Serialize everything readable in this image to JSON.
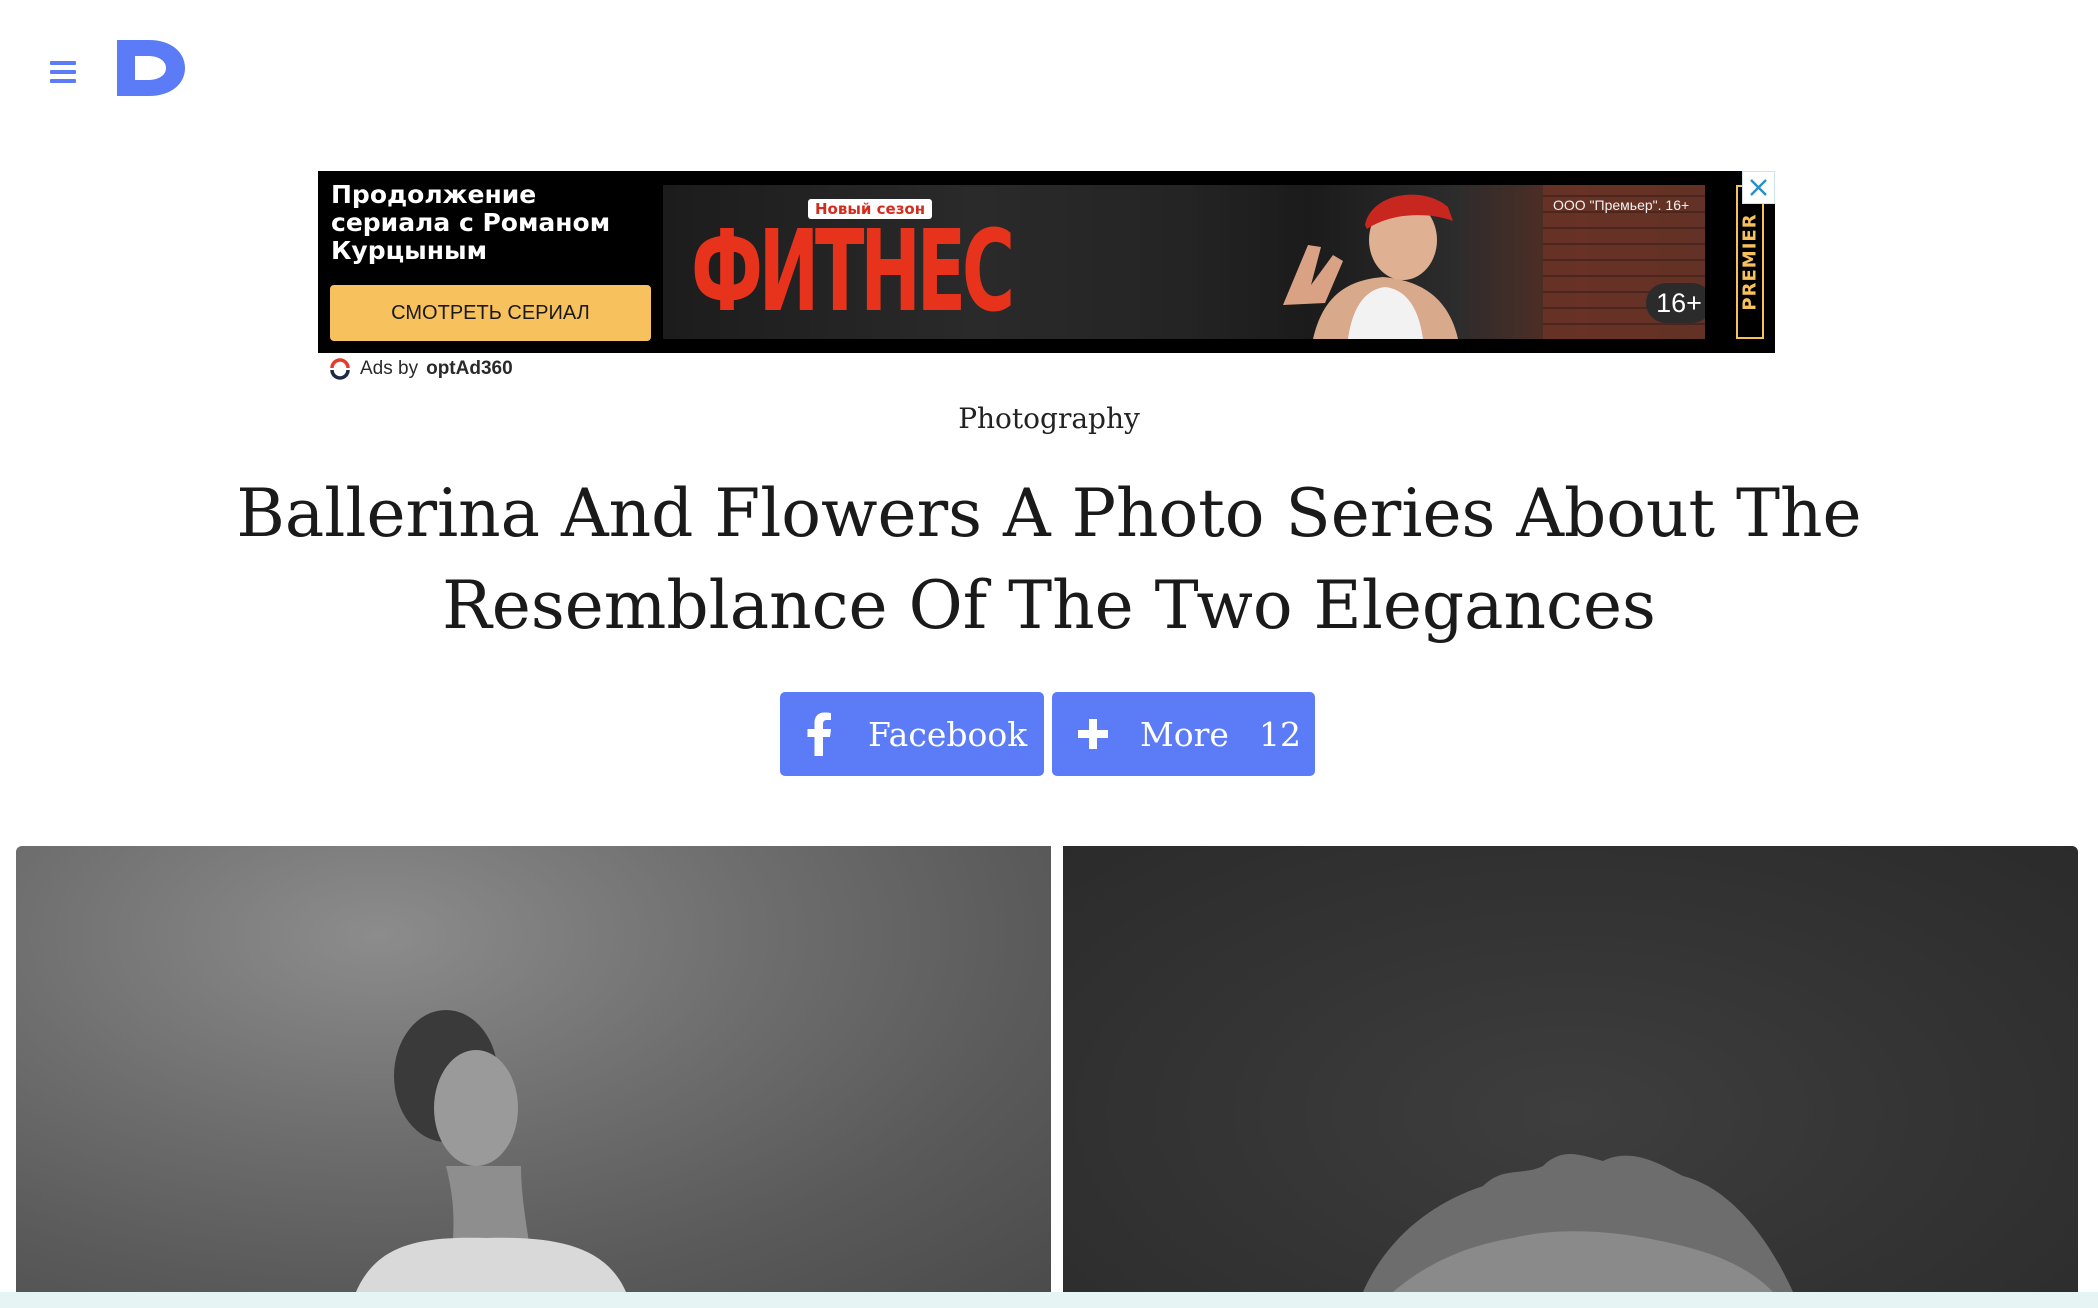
{
  "header": {
    "menu_icon": "hamburger-icon",
    "logo_letter": "D",
    "accent_color": "#5b7cf6"
  },
  "ad": {
    "headline": "Продолжение\nсериала с Романом\nКурцыным",
    "cta_label": "СМОТРЕТЬ СЕРИАЛ",
    "badge": "Новый сезон",
    "brand": "ФИТНЕС",
    "legal": "ООО \"Премьер\". 16+",
    "age_rating": "16+",
    "premier_label": "PREMIER",
    "close_icon": "close-icon",
    "provider_prefix": "Ads by",
    "provider_name": "optAd360"
  },
  "article": {
    "category": "Photography",
    "title": "Ballerina And Flowers A Photo Series About The Resemblance Of The Two Elegances"
  },
  "share": {
    "facebook_label": "Facebook",
    "facebook_icon": "facebook-icon",
    "more_label": "More",
    "more_icon": "plus-icon",
    "more_count": "12"
  }
}
